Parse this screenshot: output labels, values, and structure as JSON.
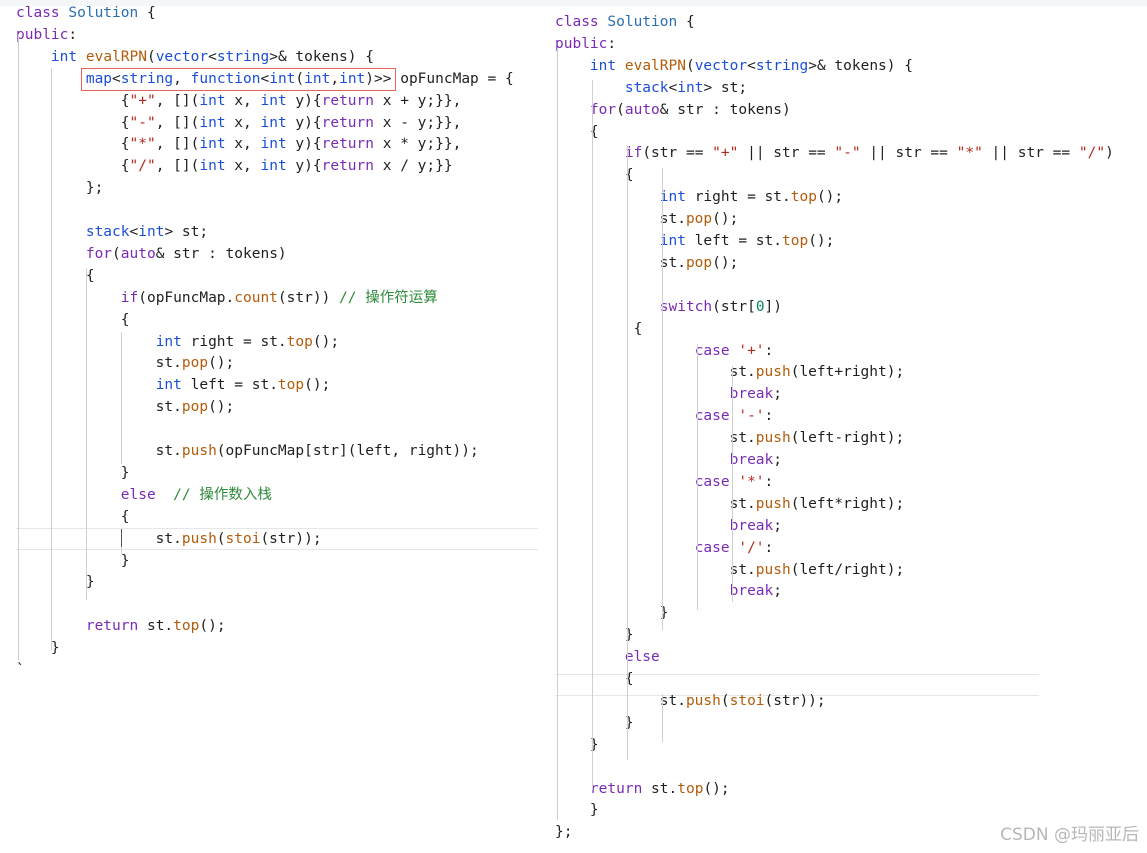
{
  "left_code": {
    "lines": [
      {
        "t": "class Solution {"
      },
      {
        "t": "public:"
      },
      {
        "t": "    int evalRPN(vector<string>& tokens) {"
      },
      {
        "t": "        map<string, function<int(int,int)>> opFuncMap = {"
      },
      {
        "t": "            {\"+\", [](int x, int y){return x + y;}},"
      },
      {
        "t": "            {\"-\", [](int x, int y){return x - y;}},"
      },
      {
        "t": "            {\"*\", [](int x, int y){return x * y;}},"
      },
      {
        "t": "            {\"/\", [](int x, int y){return x / y;}}"
      },
      {
        "t": "        };"
      },
      {
        "t": ""
      },
      {
        "t": "        stack<int> st;"
      },
      {
        "t": "        for(auto& str : tokens)"
      },
      {
        "t": "        {"
      },
      {
        "t": "            if(opFuncMap.count(str)) // 操作符运算"
      },
      {
        "t": "            {"
      },
      {
        "t": "                int right = st.top();"
      },
      {
        "t": "                st.pop();"
      },
      {
        "t": "                int left = st.top();"
      },
      {
        "t": "                st.pop();"
      },
      {
        "t": ""
      },
      {
        "t": "                st.push(opFuncMap[str](left, right));"
      },
      {
        "t": "            }"
      },
      {
        "t": "            else  // 操作数入栈"
      },
      {
        "t": "            {"
      },
      {
        "t": "                st.push(stoi(str));"
      },
      {
        "t": "            }"
      },
      {
        "t": "        }"
      },
      {
        "t": ""
      },
      {
        "t": "        return st.top();"
      },
      {
        "t": "    }"
      },
      {
        "t": "`"
      }
    ]
  },
  "right_code": {
    "lines": [
      {
        "t": "class Solution {"
      },
      {
        "t": "public:"
      },
      {
        "t": "    int evalRPN(vector<string>& tokens) {"
      },
      {
        "t": "        stack<int> st;"
      },
      {
        "t": "    for(auto& str : tokens)"
      },
      {
        "t": "    {"
      },
      {
        "t": "        if(str == \"+\" || str == \"-\" || str == \"*\" || str == \"/\")"
      },
      {
        "t": "        {"
      },
      {
        "t": "            int right = st.top();"
      },
      {
        "t": "            st.pop();"
      },
      {
        "t": "            int left = st.top();"
      },
      {
        "t": "            st.pop();"
      },
      {
        "t": ""
      },
      {
        "t": "            switch(str[0])"
      },
      {
        "t": "         {"
      },
      {
        "t": "                case '+':"
      },
      {
        "t": "                    st.push(left+right);"
      },
      {
        "t": "                    break;"
      },
      {
        "t": "                case '-':"
      },
      {
        "t": "                    st.push(left-right);"
      },
      {
        "t": "                    break;"
      },
      {
        "t": "                case '*':"
      },
      {
        "t": "                    st.push(left*right);"
      },
      {
        "t": "                    break;"
      },
      {
        "t": "                case '/':"
      },
      {
        "t": "                    st.push(left/right);"
      },
      {
        "t": "                    break;"
      },
      {
        "t": "            }"
      },
      {
        "t": "        }"
      },
      {
        "t": "        else"
      },
      {
        "t": "        {"
      },
      {
        "t": "            st.push(stoi(str));"
      },
      {
        "t": "        }"
      },
      {
        "t": "    }"
      },
      {
        "t": ""
      },
      {
        "t": "    return st.top();"
      },
      {
        "t": "    }"
      },
      {
        "t": "};"
      }
    ]
  },
  "watermark": "CSDN @玛丽亚后",
  "colors": {
    "keyword": "#7a2bb5",
    "type": "#1b4fd8",
    "function": "#b35c0b",
    "string": "#b52a1d",
    "comment": "#2e8b3a",
    "highlight_box": "#e8625a"
  }
}
